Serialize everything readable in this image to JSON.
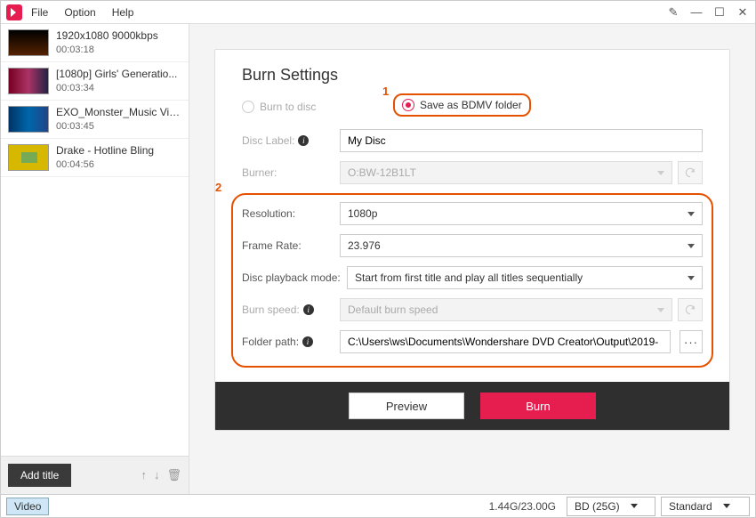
{
  "menubar": {
    "file": "File",
    "option": "Option",
    "help": "Help"
  },
  "sidebar": {
    "items": [
      {
        "title": "1920x1080 9000kbps",
        "duration": "00:03:18"
      },
      {
        "title": "[1080p] Girls' Generatio...",
        "duration": "00:03:34"
      },
      {
        "title": "EXO_Monster_Music Video",
        "duration": "00:03:45"
      },
      {
        "title": "Drake - Hotline Bling",
        "duration": "00:04:56"
      }
    ],
    "add_title": "Add title"
  },
  "burn": {
    "heading": "Burn Settings",
    "radio_disc": "Burn to disc",
    "radio_bdmv": "Save as BDMV folder",
    "disc_label_label": "Disc Label:",
    "disc_label_value": "My Disc",
    "burner_label": "Burner:",
    "burner_value": "O:BW-12B1LT",
    "resolution_label": "Resolution:",
    "resolution_value": "1080p",
    "frame_rate_label": "Frame Rate:",
    "frame_rate_value": "23.976",
    "playback_label": "Disc playback mode:",
    "playback_value": "Start from first title and play all titles sequentially",
    "burn_speed_label": "Burn speed:",
    "burn_speed_value": "Default burn speed",
    "folder_path_label": "Folder path:",
    "folder_path_value": "C:\\Users\\ws\\Documents\\Wondershare DVD Creator\\Output\\2019-",
    "preview_btn": "Preview",
    "burn_btn": "Burn",
    "annotation1": "1",
    "annotation2": "2"
  },
  "status": {
    "video_tab": "Video",
    "size": "1.44G/23.00G",
    "disc_type": "BD (25G)",
    "quality": "Standard"
  }
}
